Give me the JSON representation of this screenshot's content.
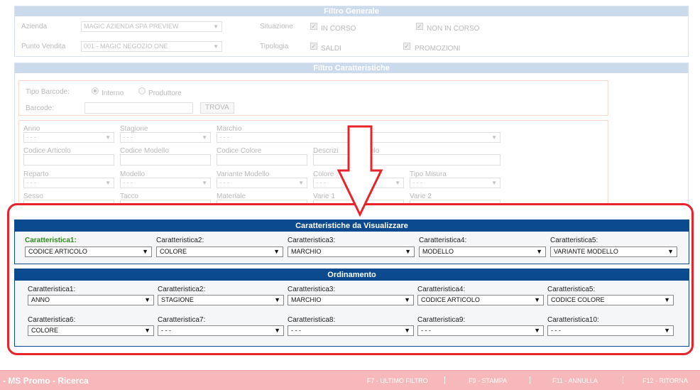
{
  "filtro_generale": {
    "title": "Filtro Generale",
    "azienda_label": "Azienda",
    "azienda_value": "MAGIC AZIENDA SPA PREVIEW",
    "punto_vendita_label": "Punto Vendita",
    "punto_vendita_value": "001 - MAGIC NEGOZIO ONE",
    "situazione_label": "Situazione",
    "tipologia_label": "Tipologia",
    "in_corso": "IN CORSO",
    "non_in_corso": "NON IN CORSO",
    "saldi": "SALDI",
    "promozioni": "PROMOZIONI"
  },
  "filtro_caratteristiche": {
    "title": "Filtro Caratteristiche",
    "tipo_barcode_label": "Tipo Barcode:",
    "interno": "Interno",
    "produttore": "Produttore",
    "barcode_label": "Barcode:",
    "trova": "TROVA",
    "empty": "- - -",
    "labels": {
      "anno": "Anno",
      "stagione": "Stagione",
      "marchio": "Marchio",
      "codice_articolo": "Codice Articolo",
      "codice_modello": "Codice Modello",
      "codice_colore": "Codice Colore",
      "descrizione": "Descrizi",
      "descrizione_tail": "olo",
      "reparto": "Reparto",
      "modello": "Modello",
      "variante_modello": "Variante Modello",
      "colore": "Colore",
      "tipo_misura": "Tipo Misura",
      "sesso": "Sesso",
      "tacco": "Tacco",
      "materiale": "Materiale",
      "varie1": "Varie 1",
      "varie2": "Varie 2"
    }
  },
  "visualizzare": {
    "title": "Caratteristiche da Visualizzare",
    "fields": [
      {
        "label": "Caratteristica1:",
        "value": "CODICE ARTICOLO"
      },
      {
        "label": "Caratteristica2:",
        "value": "COLORE"
      },
      {
        "label": "Caratteristica3:",
        "value": "MARCHIO"
      },
      {
        "label": "Caratteristica4:",
        "value": "MODELLO"
      },
      {
        "label": "Caratteristica5:",
        "value": "VARIANTE MODELLO"
      }
    ]
  },
  "ordinamento": {
    "title": "Ordinamento",
    "fields": [
      {
        "label": "Caratteristica1:",
        "value": "ANNO"
      },
      {
        "label": "Caratteristica2:",
        "value": "STAGIONE"
      },
      {
        "label": "Caratteristica3:",
        "value": "MARCHIO"
      },
      {
        "label": "Caratteristica4:",
        "value": "CODICE ARTICOLO"
      },
      {
        "label": "Caratteristica5:",
        "value": "CODICE COLORE"
      },
      {
        "label": "Caratteristica6:",
        "value": "COLORE"
      },
      {
        "label": "Caratteristica7:",
        "value": "- - -"
      },
      {
        "label": "Caratteristica8:",
        "value": "- - -"
      },
      {
        "label": "Caratteristica9:",
        "value": "- - -"
      },
      {
        "label": "Caratteristica10:",
        "value": "- - -"
      }
    ]
  },
  "footer": {
    "title": "- MS Promo - Ricerca",
    "f7": "F7 - ULTIMO FILTRO",
    "f9": "F9 - STAMPA",
    "f11": "F11 - ANNULLA",
    "f12": "F12 - RITORNA",
    "separator": "|"
  },
  "icons": {
    "dropdown": "▼",
    "check": "✓"
  },
  "colors": {
    "panel_blue": "#0b4a8f",
    "highlight_red": "#e8232a",
    "footer_pink": "#f7b8bb",
    "label_green": "#2f8a1f"
  }
}
